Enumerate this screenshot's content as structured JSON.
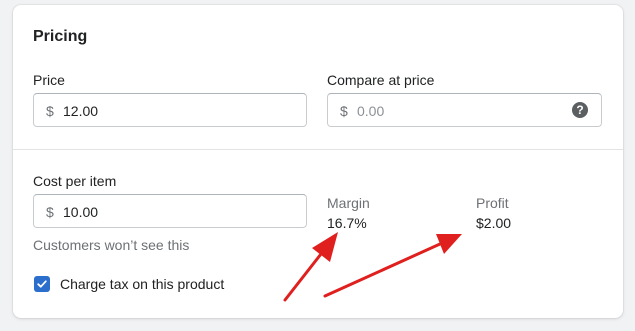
{
  "pricing": {
    "title": "Pricing",
    "price": {
      "label": "Price",
      "currency": "$",
      "value": "12.00"
    },
    "compare_at_price": {
      "label": "Compare at price",
      "currency": "$",
      "placeholder": "0.00"
    },
    "cost_per_item": {
      "label": "Cost per item",
      "currency": "$",
      "value": "10.00",
      "help_text": "Customers won’t see this"
    },
    "margin": {
      "label": "Margin",
      "value": "16.7%"
    },
    "profit": {
      "label": "Profit",
      "value": "$2.00"
    },
    "charge_tax": {
      "label": "Charge tax on this product",
      "checked": true
    }
  },
  "icons": {
    "help": "question-circle-icon",
    "check": "checkmark-icon"
  },
  "colors": {
    "accent": "#2c6ecb",
    "annotation_arrow": "#e0201e"
  }
}
